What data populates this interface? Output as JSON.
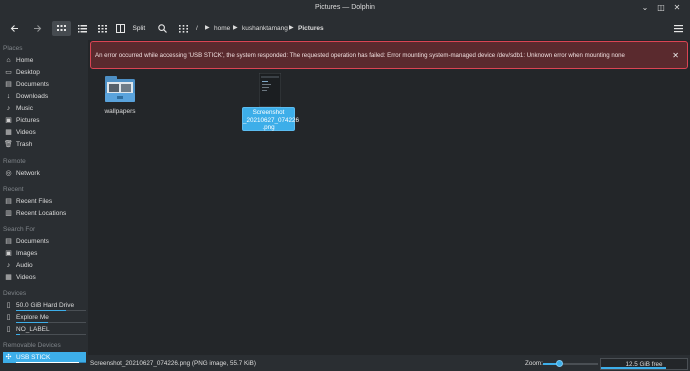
{
  "window": {
    "title": "Pictures — Dolphin"
  },
  "toolbar": {
    "back_icon": "arrow-left-icon",
    "forward_icon": "arrow-right-icon",
    "split_label": "Split",
    "breadcrumb": [
      "/",
      "home",
      "kushanktamang",
      "Pictures"
    ]
  },
  "sidebar": {
    "places_header": "Places",
    "places": [
      {
        "label": "Home",
        "icon": "home-icon"
      },
      {
        "label": "Desktop",
        "icon": "desktop-icon"
      },
      {
        "label": "Documents",
        "icon": "documents-icon"
      },
      {
        "label": "Downloads",
        "icon": "downloads-icon"
      },
      {
        "label": "Music",
        "icon": "music-icon"
      },
      {
        "label": "Pictures",
        "icon": "pictures-icon"
      },
      {
        "label": "Videos",
        "icon": "videos-icon"
      },
      {
        "label": "Trash",
        "icon": "trash-icon"
      }
    ],
    "remote_header": "Remote",
    "remote": [
      {
        "label": "Network",
        "icon": "network-icon"
      }
    ],
    "recent_header": "Recent",
    "recent": [
      {
        "label": "Recent Files",
        "icon": "recent-files-icon"
      },
      {
        "label": "Recent Locations",
        "icon": "recent-locations-icon"
      }
    ],
    "search_header": "Search For",
    "search": [
      {
        "label": "Documents",
        "icon": "documents-icon"
      },
      {
        "label": "Images",
        "icon": "images-icon"
      },
      {
        "label": "Audio",
        "icon": "audio-icon"
      },
      {
        "label": "Videos",
        "icon": "videos-icon"
      }
    ],
    "devices_header": "Devices",
    "devices": [
      {
        "label": "50.0 GiB Hard Drive",
        "icon": "drive-icon",
        "used": 0.72
      },
      {
        "label": "Explore Me",
        "icon": "drive-icon",
        "used": 0.45
      },
      {
        "label": "NO_LABEL",
        "icon": "drive-icon",
        "used": 0.05
      }
    ],
    "removable_header": "Removable Devices",
    "removable": [
      {
        "label": "USB STICK",
        "icon": "usb-icon",
        "used": 0.9
      }
    ]
  },
  "error": {
    "message": "An error occurred while accessing 'USB STICK', the system responded: The requested operation has failed: Error mounting system-managed device /dev/sdb1: Unknown error when mounting none"
  },
  "files": [
    {
      "name": "wallpapers",
      "icon": "folder-pictures-icon"
    },
    {
      "name": "Screenshot_20210627_074226.png",
      "label_lines": [
        "Screenshot",
        "_20210627_074226",
        ".png"
      ],
      "icon": "image-file-icon",
      "selected": true
    }
  ],
  "statusbar": {
    "selection_text": "Screenshot_20210627_074226.png (PNG image, 55.7 KiB)",
    "zoom_label": "Zoom:",
    "zoom_level": 0.3,
    "free_space": "12.5 GiB free",
    "free_used": 0.75
  },
  "colors": {
    "accent": "#3daee9",
    "error_border": "#da4453"
  }
}
